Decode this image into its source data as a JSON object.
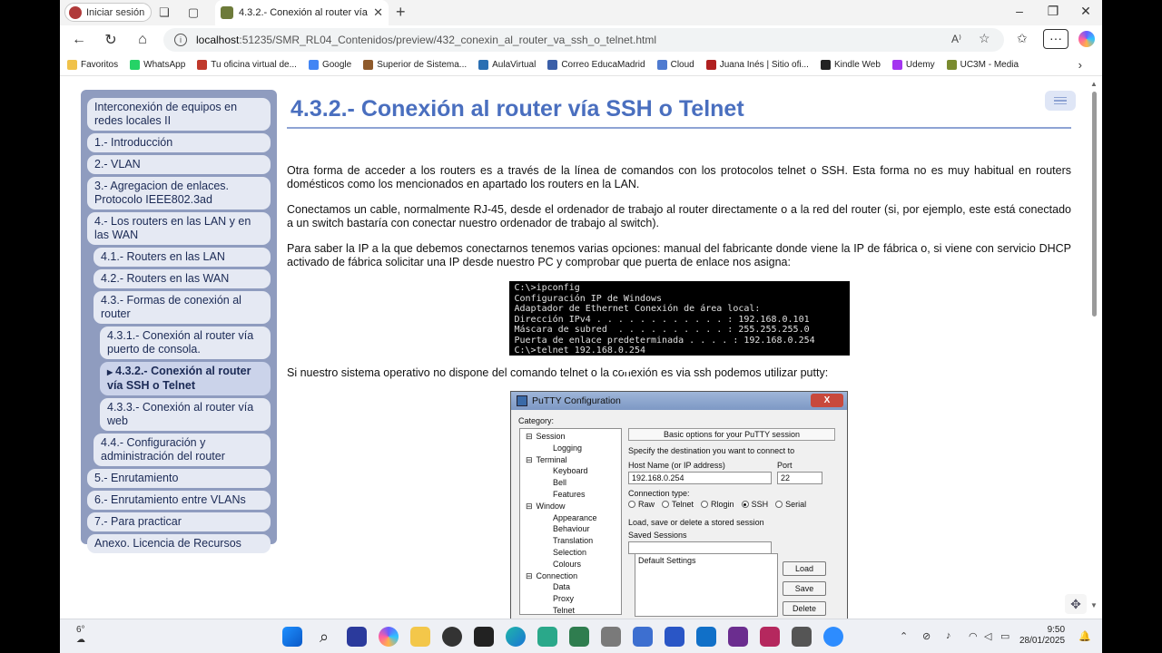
{
  "browser": {
    "signin_label": "Iniciar sesión",
    "tab_title": "4.3.2.- Conexión al router vía SSH",
    "url_host": "localhost",
    "url_rest": ":51235/SMR_RL04_Contenidos/preview/432_conexin_al_router_va_ssh_o_telnet.html",
    "read_aloud": "A⁾",
    "bookmarks": [
      {
        "label": "Favoritos",
        "color": "#f0c24a"
      },
      {
        "label": "WhatsApp",
        "color": "#25d366"
      },
      {
        "label": "Tu oficina virtual de...",
        "color": "#c0392b"
      },
      {
        "label": "Google",
        "color": "#4285f4"
      },
      {
        "label": "Superior de Sistema...",
        "color": "#8e5a2b"
      },
      {
        "label": "AulaVirtual",
        "color": "#2a6fb3"
      },
      {
        "label": "Correo EducaMadrid",
        "color": "#3b5fa8"
      },
      {
        "label": "Cloud",
        "color": "#4f7bd0"
      },
      {
        "label": "Juana Inés | Sitio ofi...",
        "color": "#b02020"
      },
      {
        "label": "Kindle Web",
        "color": "#222222"
      },
      {
        "label": "Udemy",
        "color": "#a435f0"
      },
      {
        "label": "UC3M - Media",
        "color": "#7a8b2f"
      }
    ]
  },
  "sidebar": {
    "items": [
      {
        "label": "Interconexión de equipos en redes locales II",
        "level": 1
      },
      {
        "label": "1.- Introducción",
        "level": 1
      },
      {
        "label": "2.- VLAN",
        "level": 1
      },
      {
        "label": "3.- Agregacion de enlaces. Protocolo IEEE802.3ad",
        "level": 1
      },
      {
        "label": "4.- Los routers en las LAN y en las WAN",
        "level": 1
      },
      {
        "label": "4.1.- Routers en las LAN",
        "level": 2
      },
      {
        "label": "4.2.- Routers en las WAN",
        "level": 2
      },
      {
        "label": "4.3.- Formas de conexión al router",
        "level": 2
      },
      {
        "label": "4.3.1.- Conexión al router vía puerto de consola.",
        "level": 3
      },
      {
        "label": "4.3.2.- Conexión al router vía SSH o Telnet",
        "level": 3,
        "active": true
      },
      {
        "label": "4.3.3.- Conexión al router vía web",
        "level": 3
      },
      {
        "label": "4.4.- Configuración y administración del router",
        "level": 2
      },
      {
        "label": "5.- Enrutamiento",
        "level": 1
      },
      {
        "label": "6.- Enrutamiento entre VLANs",
        "level": 1
      },
      {
        "label": "7.- Para practicar",
        "level": 1
      },
      {
        "label": "Anexo. Licencia de Recursos",
        "level": 1
      }
    ]
  },
  "content": {
    "title": "4.3.2.- Conexión al router vía SSH o Telnet",
    "p1": "Otra forma de acceder a los routers es a través de la línea de comandos con los protocolos telnet o SSH. Esta forma no es muy habitual en routers domésticos como los mencionados en apartado los routers en la LAN.",
    "p2": "Conectamos un cable, normalmente RJ-45, desde el ordenador de trabajo al router directamente o a la red del router (si, por ejemplo, este está conectado a un switch bastaría con conectar nuestro ordenador de trabajo al switch).",
    "p3": "Para saber la IP a la que debemos conectarnos tenemos varias opciones: manual del fabricante donde viene la IP de fábrica o, si viene con servicio DHCP activado de fábrica solicitar una IP desde nuestro PC y comprobar que puerta de enlace nos asigna:",
    "console": "C:\\>ipconfig\nConfiguración IP de Windows\nAdaptador de Ethernet Conexión de área local:\nDirección IPv4 . . . . . . . . . . . . : 192.168.0.101\nMáscara de subred  . . . . . . . . . . : 255.255.255.0\nPuerta de enlace predeterminada . . . . : 192.168.0.254\nC:\\>telnet 192.168.0.254",
    "p4": "Si nuestro sistema operativo no dispone del comando telnet o la conexión es via ssh podemos utilizar putty:"
  },
  "putty": {
    "title": "PuTTY Configuration",
    "close": "X",
    "category": "Category:",
    "tree": [
      {
        "label": "Session",
        "level": 0,
        "exp": "⊟"
      },
      {
        "label": "Logging",
        "level": 1
      },
      {
        "label": "Terminal",
        "level": 0,
        "exp": "⊟"
      },
      {
        "label": "Keyboard",
        "level": 1
      },
      {
        "label": "Bell",
        "level": 1
      },
      {
        "label": "Features",
        "level": 1
      },
      {
        "label": "Window",
        "level": 0,
        "exp": "⊟"
      },
      {
        "label": "Appearance",
        "level": 1
      },
      {
        "label": "Behaviour",
        "level": 1
      },
      {
        "label": "Translation",
        "level": 1
      },
      {
        "label": "Selection",
        "level": 1
      },
      {
        "label": "Colours",
        "level": 1
      },
      {
        "label": "Connection",
        "level": 0,
        "exp": "⊟"
      },
      {
        "label": "Data",
        "level": 1
      },
      {
        "label": "Proxy",
        "level": 1
      },
      {
        "label": "Telnet",
        "level": 1
      }
    ],
    "banner": "Basic options for your PuTTY session",
    "dest_label": "Specify the destination you want to connect to",
    "host_label": "Host Name (or IP address)",
    "port_label": "Port",
    "host_value": "192.168.0.254",
    "port_value": "22",
    "conn_type_label": "Connection type:",
    "conn_types": [
      "Raw",
      "Telnet",
      "Rlogin",
      "SSH",
      "Serial"
    ],
    "conn_selected": "SSH",
    "load_label": "Load, save or delete a stored session",
    "saved_label": "Saved Sessions",
    "default_session": "Default Settings",
    "btn_load": "Load",
    "btn_save": "Save",
    "btn_delete": "Delete"
  },
  "taskbar": {
    "temp": "6°",
    "time": "9:50",
    "date": "28/01/2025"
  }
}
